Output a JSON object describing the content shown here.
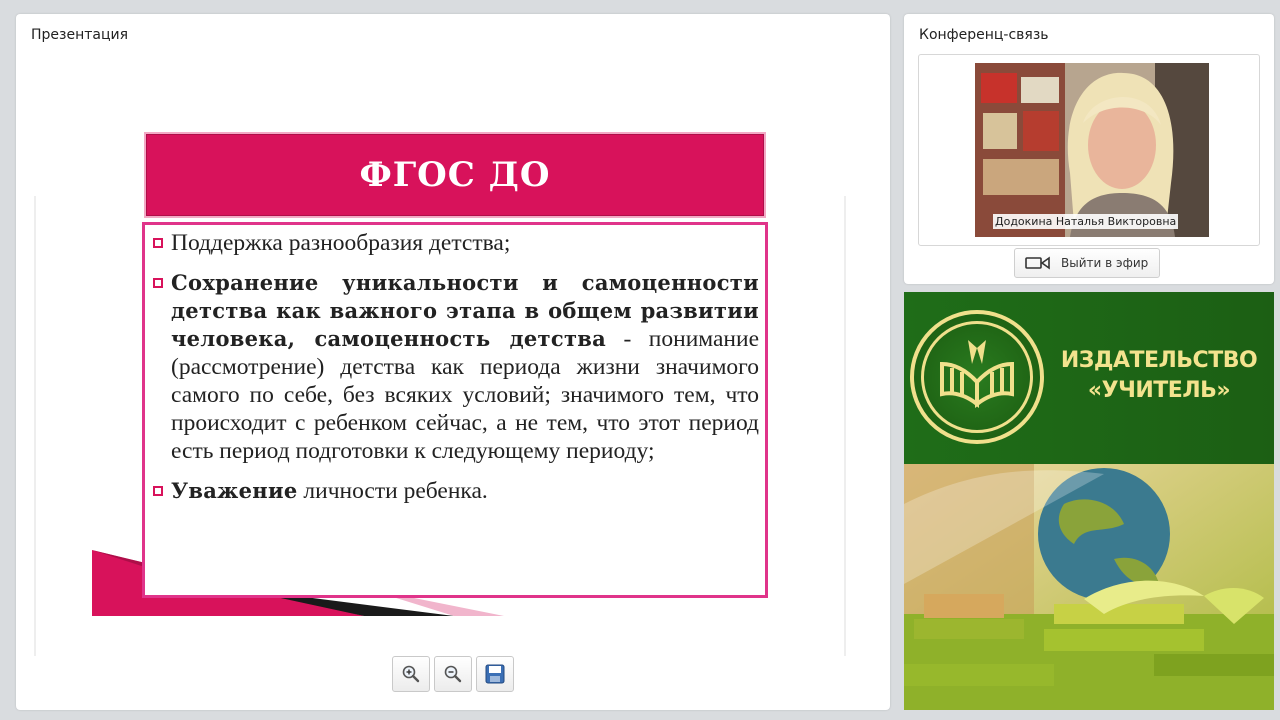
{
  "presentation": {
    "title": "Презентация",
    "slide": {
      "heading": "ФГОС ДО",
      "bullets": [
        {
          "bold": "",
          "text": "Поддержка разнообразия детства;"
        },
        {
          "bold": "Сохранение уникальности и самоценности детства как важного этапа в общем развитии человека, самоценность детства",
          "text": " - понимание (рассмотрение) детства как периода жизни значимого самого по себе, без всяких условий; значимого тем, что происходит с ребенком сейчас, а не тем, что этот период есть период подготовки к следующему периоду;"
        },
        {
          "bold": "Уважение",
          "text": " личности ребенка."
        }
      ]
    },
    "toolbar": {
      "zoom_in_icon": "zoom-in-icon",
      "zoom_out_icon": "zoom-out-icon",
      "save_icon": "floppy-disk-icon"
    }
  },
  "conference": {
    "title": "Конференц-связь",
    "participant_name": "Додокина Наталья Викторовна",
    "go_live_label": "Выйти в эфир"
  },
  "ad": {
    "line1": "ИЗДАТЕЛЬСТВО",
    "line2": "«УЧИТЕЛЬ»"
  },
  "colors": {
    "accent": "#d8125b",
    "box_border": "#e0348a",
    "ad_green": "#1f6d18",
    "ad_gold": "#f3e38e"
  }
}
